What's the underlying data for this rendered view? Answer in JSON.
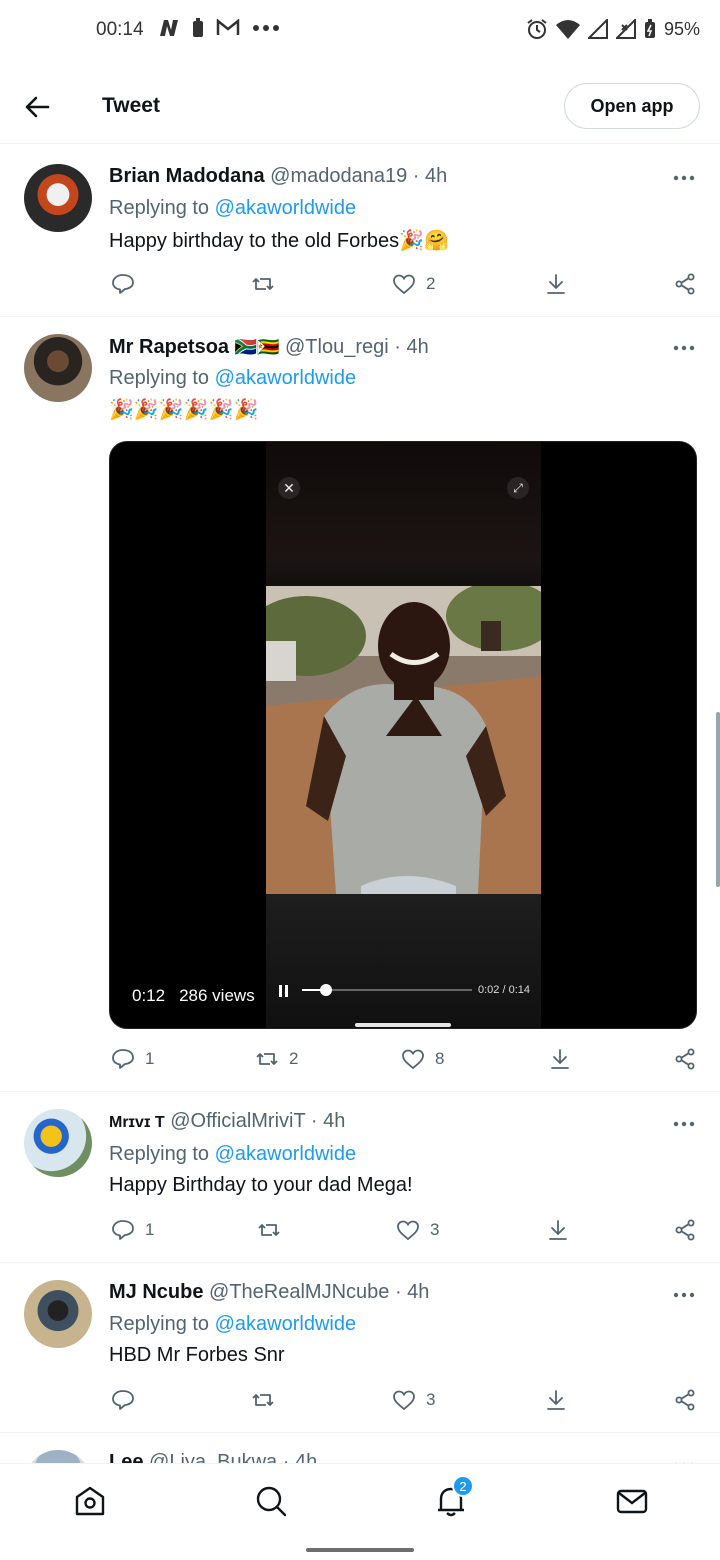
{
  "status_bar": {
    "time": "00:14",
    "battery": "95%"
  },
  "header": {
    "title": "Tweet",
    "open_app": "Open app"
  },
  "replying_label": "Replying to",
  "replying_handle": "@akaworldwide",
  "tweets": [
    {
      "name": "Brian Madodana",
      "handle": "@madodana19",
      "time": "· 4h",
      "text": "Happy birthday to the old Forbes🎉🤗",
      "likes": "2",
      "replies": "",
      "retweets": ""
    },
    {
      "name": "Mr Rapetsoa",
      "flags": "🇿🇦🇿🇼",
      "handle": "@Tlou_regi",
      "time": "· 4h",
      "text": "🎉🎉🎉🎉🎉🎉",
      "replies": "1",
      "retweets": "2",
      "likes": "8"
    },
    {
      "name": "Mrɪvɪ T",
      "handle": "@OfficialMriviT",
      "time": "· 4h",
      "text": "Happy Birthday to your dad Mega!",
      "replies": "1",
      "retweets": "",
      "likes": "3"
    },
    {
      "name": "MJ Ncube",
      "handle": "@TheRealMJNcube",
      "time": "· 4h",
      "text": "HBD Mr Forbes Snr",
      "replies": "",
      "retweets": "",
      "likes": "3"
    },
    {
      "name": "Lee",
      "handle": "@Liya_Bukwa",
      "time": "· 4h"
    }
  ],
  "video": {
    "elapsed": "0:12",
    "views": "286 views",
    "player_time": "0:02 / 0:14",
    "progress": 0.14
  },
  "bottom_nav": {
    "notifications_badge": "2"
  }
}
